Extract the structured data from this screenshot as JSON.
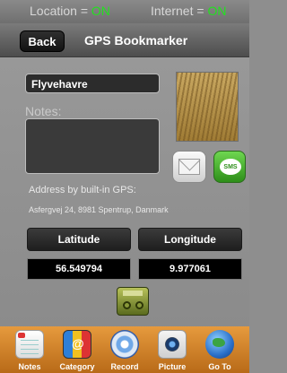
{
  "status_bar": {
    "location_label": "Location =",
    "location_value": "ON",
    "internet_label": "Internet =",
    "internet_value": "ON"
  },
  "nav": {
    "back_label": "Back",
    "title": "GPS Bookmarker"
  },
  "bookmark": {
    "name_value": "Flyvehavre",
    "notes_label": "Notes:",
    "notes_value": "",
    "address_label": "Address by built-in GPS:",
    "address_value": "Asfergvej 24, 8981 Spentrup, Danmark"
  },
  "share": {
    "sms_label": "SMS"
  },
  "coordinates": {
    "latitude_label": "Latitude",
    "longitude_label": "Longitude",
    "latitude_value": "56.549794",
    "longitude_value": "9.977061"
  },
  "toolbar": {
    "items": [
      {
        "label": "Notes",
        "icon": "notes-icon"
      },
      {
        "label": "Category",
        "icon": "category-icon",
        "glyph": "@"
      },
      {
        "label": "Record",
        "icon": "record-icon"
      },
      {
        "label": "Picture",
        "icon": "picture-icon"
      },
      {
        "label": "Go To",
        "icon": "globe-icon"
      }
    ]
  },
  "colors": {
    "status_on": "#22e21f",
    "toolbar_bg": "#d4882b",
    "sms_green": "#3fae26"
  }
}
